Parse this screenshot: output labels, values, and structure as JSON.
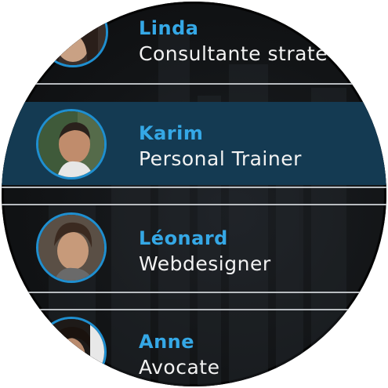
{
  "contacts": [
    {
      "name": "Linda",
      "role": "Consultante straté",
      "selected": false
    },
    {
      "name": "Karim",
      "role": "Personal Trainer",
      "selected": true
    },
    {
      "name": "Léonard",
      "role": "Webdesigner",
      "selected": false
    },
    {
      "name": "Anne",
      "role": "Avocate",
      "selected": false
    }
  ],
  "colors": {
    "accent": "#35a8e6",
    "selected_bg": "#143a52",
    "avatar_ring": "#1f8fd0",
    "background": "#121416"
  }
}
